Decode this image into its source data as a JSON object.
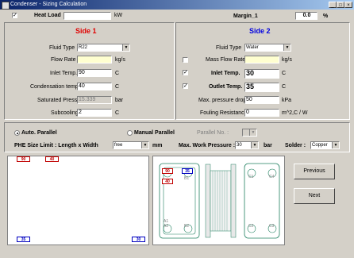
{
  "window": {
    "title": "Condenser - Sizing Calculation"
  },
  "top": {
    "heat_load_label": "Heat Load",
    "heat_load_value": "",
    "heat_load_unit": "kW",
    "margin_label": "Margin_1",
    "margin_value": "0.0",
    "margin_unit": "%"
  },
  "side1": {
    "title": "Side 1",
    "fluid_type_label": "Fluid  Type",
    "fluid_type": "R22",
    "flow_rate_label": "Flow  Rate",
    "flow_rate": "",
    "flow_rate_unit": "kg/s",
    "inlet_temp_label": "Inlet  Temp.",
    "inlet_temp": "90",
    "inlet_temp_unit": "C",
    "cond_temp_label": "Condensation temp",
    "cond_temp": "40",
    "cond_temp_unit": "C",
    "sat_press_label": "Saturated Press.",
    "sat_press": "15.339",
    "sat_press_unit": "bar",
    "subcooling_label": "Subcooling",
    "subcooling": "2",
    "subcooling_unit": "C"
  },
  "side2": {
    "title": "Side 2",
    "fluid_type_label": "Fluid  Type",
    "fluid_type": "Water",
    "mass_flow_label": "Mass Flow Rate",
    "mass_flow": "",
    "mass_flow_unit": "kg/s",
    "inlet_temp_label": "Inlet  Temp.",
    "inlet_temp": "30",
    "inlet_temp_unit": "C",
    "outlet_temp_label": "Outlet  Temp.",
    "outlet_temp": "35",
    "outlet_temp_unit": "C",
    "max_pd_label": "Max. pressure drop",
    "max_pd": "50",
    "max_pd_unit": "kPa",
    "fouling_label": "Fouling Resistance",
    "fouling": "0",
    "fouling_unit": "m^2,C / W"
  },
  "options": {
    "auto_parallel": "Auto. Parallel",
    "manual_parallel": "Manual Parallel",
    "parallel_no_label": "Parallel No. :",
    "parallel_no": "",
    "phe_size_label": "PHE Size Limit : Length x Width",
    "phe_size": "free",
    "phe_size_unit": "mm",
    "max_work_pressure_label": "Max. Work Pressure :",
    "max_work_pressure": "30",
    "max_work_pressure_unit": "bar",
    "solder_label": "Solder :",
    "solder": "Copper"
  },
  "preview": {
    "tag_tl": "90",
    "tag_tr": "40",
    "tag_bl": "35",
    "tag_br": "30"
  },
  "diagram": {
    "tag_a": "90",
    "tag_b": "35",
    "tag_c": "40",
    "port_b1": "B1",
    "port_a1": "A1",
    "port_a2": "A2",
    "port_b2": "B2",
    "port_c1": "C1",
    "port_c4": "C4",
    "port_c2": "C2",
    "port_c3": "C3"
  },
  "buttons": {
    "previous": "Previous",
    "next": "Next"
  }
}
